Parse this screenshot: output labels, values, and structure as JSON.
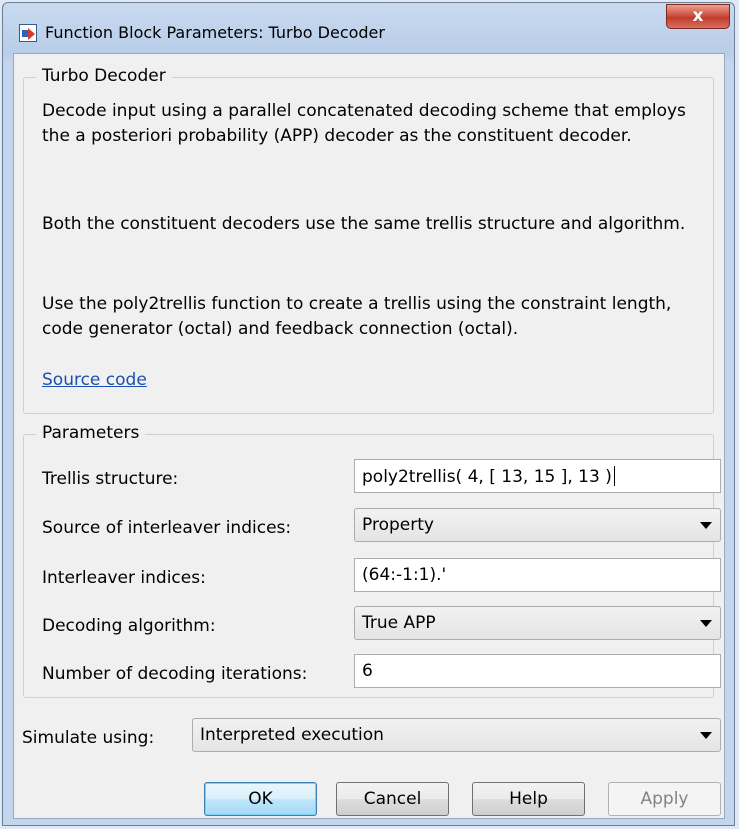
{
  "window": {
    "title": "Function Block Parameters: Turbo Decoder",
    "close_label": "x"
  },
  "description_group": {
    "title": "Turbo Decoder",
    "paragraphs": [
      "Decode input using a parallel concatenated decoding scheme that employs the a posteriori probability (APP) decoder as the constituent decoder.",
      "Both the constituent decoders use the same trellis structure and algorithm.",
      "Use the poly2trellis function to create a trellis using the constraint length, code generator (octal) and feedback connection (octal)."
    ],
    "link": "Source code"
  },
  "parameters": {
    "title": "Parameters",
    "trellis_label": "Trellis structure:",
    "trellis_value": "poly2trellis( 4, [ 13, 15 ], 13 )",
    "interleaver_source_label": "Source of interleaver indices:",
    "interleaver_source_value": "Property",
    "interleaver_indices_label": "Interleaver indices:",
    "interleaver_indices_value": "(64:-1:1).'",
    "algorithm_label": "Decoding algorithm:",
    "algorithm_value": "True APP",
    "iterations_label": "Number of decoding iterations:",
    "iterations_value": "6"
  },
  "simulate": {
    "label": "Simulate using:",
    "value": "Interpreted execution"
  },
  "buttons": {
    "ok": "OK",
    "cancel": "Cancel",
    "help": "Help",
    "apply": "Apply"
  },
  "colors": {
    "link": "#1b4fb2",
    "close_button": "#c13a2a",
    "default_button": "#bee6fd"
  }
}
